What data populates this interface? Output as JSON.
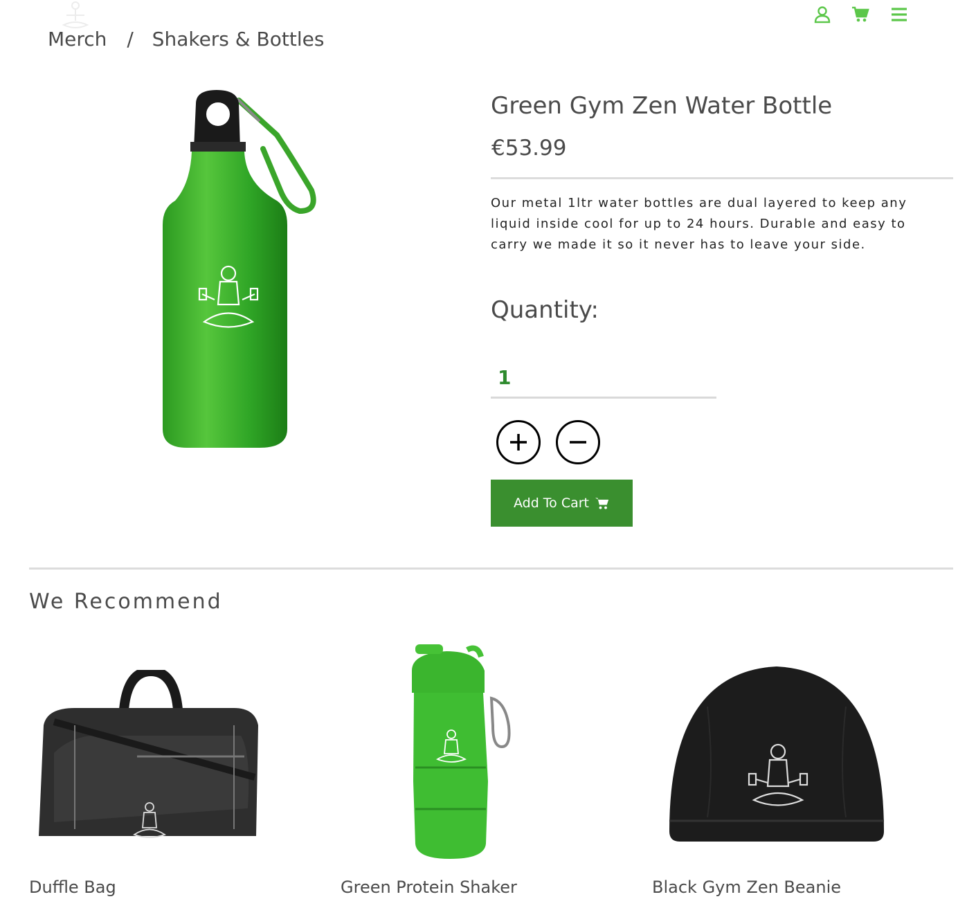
{
  "header": {
    "icons": [
      "meditating-logo-icon",
      "user-icon",
      "cart-icon",
      "menu-icon"
    ],
    "accent_color": "#5cc74a"
  },
  "breadcrumb": {
    "items": [
      "Merch",
      "Shakers & Bottles"
    ],
    "separator": "/"
  },
  "product": {
    "title": "Green Gym Zen Water Bottle",
    "price": "€53.99",
    "description": "Our metal 1ltr water bottles are dual layered to keep any liquid inside cool for up to 24 hours. Durable and easy to carry we made it so it never has to leave your side.",
    "quantity_label": "Quantity:",
    "quantity_value": "1",
    "add_to_cart_label": "Add To Cart",
    "button_color": "#3a8f2f"
  },
  "recommend": {
    "heading": "We Recommend",
    "items": [
      {
        "name": "Duffle Bag"
      },
      {
        "name": "Green Protein Shaker"
      },
      {
        "name": "Black Gym Zen Beanie"
      }
    ]
  }
}
